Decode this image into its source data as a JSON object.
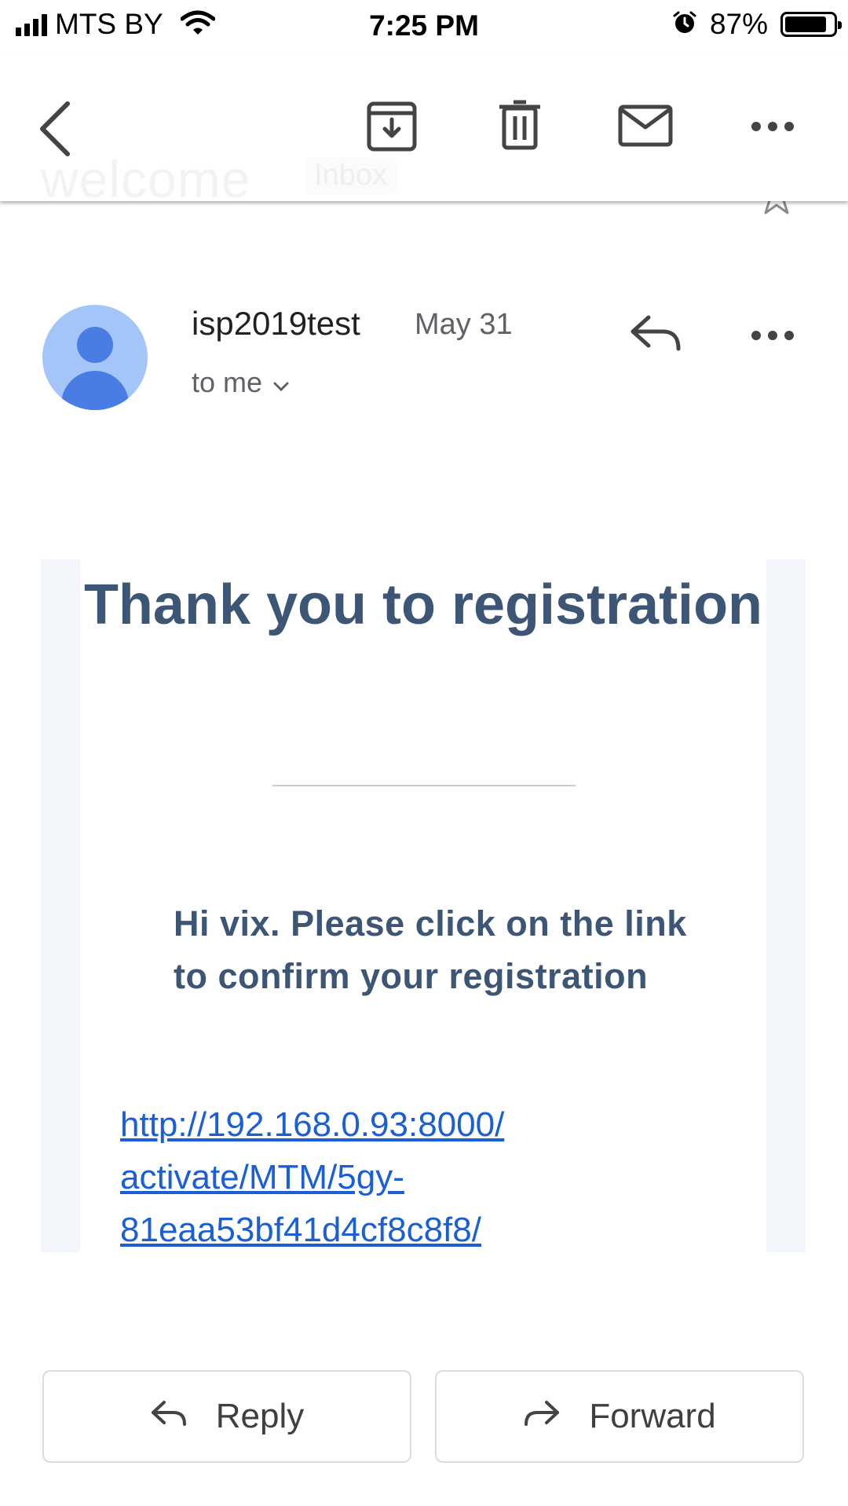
{
  "status_bar": {
    "carrier": "MTS BY",
    "time": "7:25 PM",
    "battery_percent": "87%",
    "battery_level": 0.87,
    "icons": [
      "signal-icon",
      "wifi-icon",
      "alarm-icon",
      "battery-icon"
    ]
  },
  "toolbar": {
    "ghost_subject": "welcome",
    "ghost_label": "Inbox",
    "actions": [
      "back-icon",
      "archive-icon",
      "delete-icon",
      "mark-unread-icon",
      "more-icon"
    ]
  },
  "message": {
    "sender": "isp2019test",
    "date": "May 31",
    "recipient": "to me",
    "headline": "Thank you to registration",
    "body": "Hi vix. Please click on the link to confirm your registration",
    "link_lines": [
      "http://192.168.0.93:8000/",
      "activate/MTM/5gy-",
      "81eaa53bf41d4cf8c8f8/"
    ]
  },
  "actions": {
    "reply_label": "Reply",
    "forward_label": "Forward"
  },
  "colors": {
    "headline": "#3d5675",
    "link": "#1a5fd6",
    "avatar_bg": "#a3c5f8",
    "avatar_fg": "#4a7de3"
  }
}
